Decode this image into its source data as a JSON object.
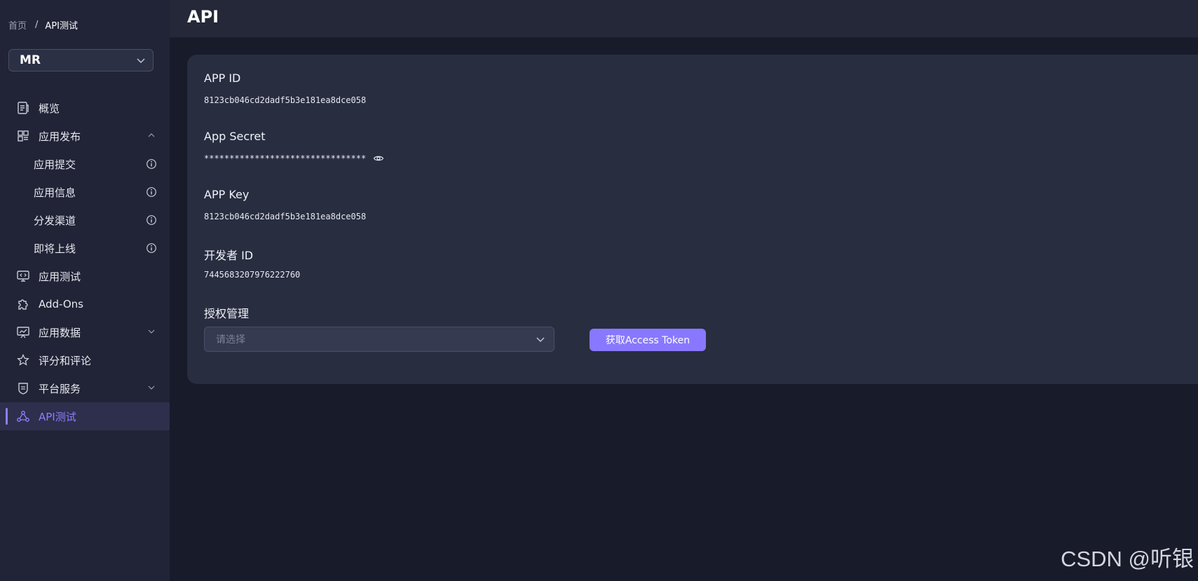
{
  "breadcrumb": {
    "home": "首页",
    "separator": "/",
    "current": "API测试"
  },
  "app_selector": {
    "value": "MR"
  },
  "nav": {
    "overview": "概览",
    "publish": "应用发布",
    "submit": "应用提交",
    "info": "应用信息",
    "channel": "分发渠道",
    "upcoming": "即将上线",
    "testing": "应用测试",
    "addons": "Add-Ons",
    "data": "应用数据",
    "reviews": "评分和评论",
    "services": "平台服务",
    "api_test": "API测试"
  },
  "header": {
    "title": "API"
  },
  "fields": {
    "app_id": {
      "label": "APP ID",
      "value": "8123cb046cd2dadf5b3e181ea8dce058"
    },
    "app_secret": {
      "label": "App Secret",
      "value": "********************************"
    },
    "app_key": {
      "label": "APP Key",
      "value": "8123cb046cd2dadf5b3e181ea8dce058"
    },
    "developer_id": {
      "label": "开发者 ID",
      "value": "7445683207976222760"
    },
    "auth": {
      "label": "授权管理",
      "placeholder": "请选择"
    }
  },
  "buttons": {
    "get_token": "获取Access Token"
  },
  "watermark": "CSDN @听银",
  "colors": {
    "accent": "#8878ff",
    "active_nav": "#8e7dff",
    "card": "#292d40",
    "sidebar": "#212436"
  }
}
